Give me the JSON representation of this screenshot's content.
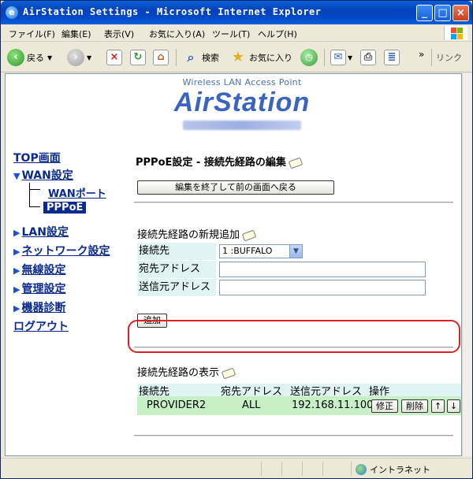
{
  "window": {
    "title": "AirStation Settings - Microsoft Internet Explorer"
  },
  "menubar": {
    "items": [
      "ファイル(F)",
      "編集(E)",
      "表示(V)",
      "お気に入り(A)",
      "ツール(T)",
      "ヘルプ(H)"
    ]
  },
  "toolbar": {
    "back_label": "戻る",
    "search_label": "検索",
    "favorites_label": "お気に入り",
    "links_label": "リンク"
  },
  "status": {
    "zone_label": "イントラネット"
  },
  "logo": {
    "subtitle": "Wireless LAN Access Point",
    "brand": "AirStation"
  },
  "nav": {
    "top": "TOP画面",
    "wan": "WAN設定",
    "wan_port": "WANポート",
    "pppoe": "PPPoE",
    "lan": "LAN設定",
    "network": "ネットワーク設定",
    "wireless": "無線設定",
    "admin": "管理設定",
    "diag": "機器診断",
    "logout": "ログアウト"
  },
  "main": {
    "page_title": "PPPoE設定 - 接続先経路の編集",
    "back_button": "編集を終了して前の画面へ戻る",
    "add_section_title": "接続先経路の新規追加",
    "form": {
      "destination_label": "接続先",
      "destination_value": "1 :BUFFALO",
      "dest_address_label": "宛先アドレス",
      "src_address_label": "送信元アドレス"
    },
    "add_button": "追加",
    "list_section_title": "接続先経路の表示",
    "list_headers": [
      "接続先",
      "宛先アドレス",
      "送信元アドレス",
      "操作"
    ],
    "row": {
      "destination": "PROVIDER2",
      "dest_address": "ALL",
      "src_address": "192.168.11.100",
      "edit_button": "修正",
      "delete_button": "削除",
      "up_button": "↑",
      "down_button": "↓"
    }
  }
}
